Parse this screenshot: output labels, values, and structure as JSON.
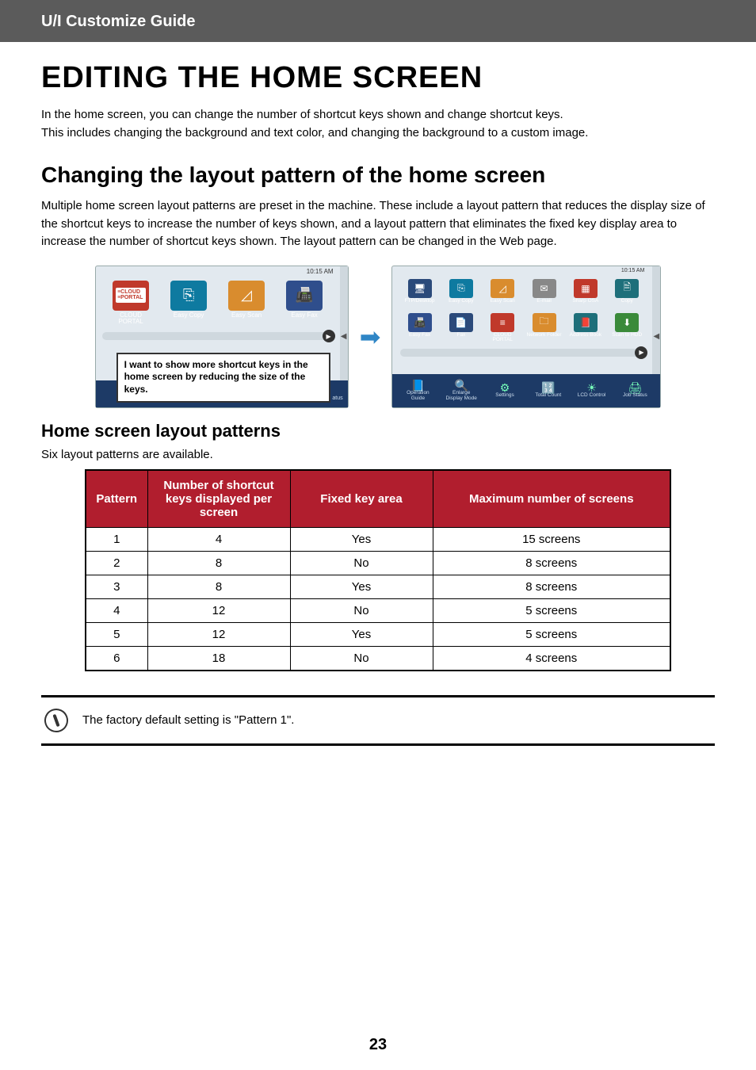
{
  "header": {
    "title": "U/I Customize Guide"
  },
  "h1": "EDITING THE HOME SCREEN",
  "intro_line1": "In the home screen, you can change the number of shortcut keys shown and change shortcut keys.",
  "intro_line2": "This includes changing the background and text color, and changing the background to a custom image.",
  "h2": "Changing the layout pattern of the home screen",
  "body": "Multiple home screen layout patterns are preset in the machine. These include a layout pattern that reduces the display size of the shortcut keys to increase the number of keys shown, and a layout pattern that eliminates the fixed key display area to increase the number of shortcut keys shown. The layout pattern can be changed in the Web page.",
  "mock_left": {
    "time": "10:15 AM",
    "icons": [
      {
        "label": "CLOUD PORTAL"
      },
      {
        "label": "Easy Copy"
      },
      {
        "label": "Easy Scan"
      },
      {
        "label": "Easy Fax"
      }
    ],
    "callout": "I want to show more shortcut keys in the home screen by reducing the size of the keys.",
    "status_stub": "atus"
  },
  "mock_right": {
    "time": "10:15 AM",
    "row1": [
      {
        "label": "FTP/Desktop"
      },
      {
        "label": "Easy Copy"
      },
      {
        "label": "Easy Scan"
      },
      {
        "label": "E-mail"
      },
      {
        "label": "Sharp OSA"
      },
      {
        "label": "Copy"
      }
    ],
    "row2": [
      {
        "label": "Easy Fax"
      },
      {
        "label": "Fax"
      },
      {
        "label": "CLOUD PORTAL"
      },
      {
        "label": "Network Folder"
      },
      {
        "label": "Address Book"
      },
      {
        "label": "Scan to HDD"
      }
    ],
    "bottom": [
      {
        "label": "Operation Guide"
      },
      {
        "label": "Enlarge Display Mode"
      },
      {
        "label": "Settings"
      },
      {
        "label": "Total Count"
      },
      {
        "label": "LCD Control"
      },
      {
        "label": "Job Status"
      }
    ]
  },
  "h3": "Home screen layout patterns",
  "patterns_intro": "Six layout patterns are available.",
  "table": {
    "headers": [
      "Pattern",
      "Number of shortcut keys displayed per screen",
      "Fixed key area",
      "Maximum number of screens"
    ],
    "rows": [
      [
        "1",
        "4",
        "Yes",
        "15 screens"
      ],
      [
        "2",
        "8",
        "No",
        "8 screens"
      ],
      [
        "3",
        "8",
        "Yes",
        "8 screens"
      ],
      [
        "4",
        "12",
        "No",
        "5 screens"
      ],
      [
        "5",
        "12",
        "Yes",
        "5 screens"
      ],
      [
        "6",
        "18",
        "No",
        "4 screens"
      ]
    ]
  },
  "note": "The factory default setting is \"Pattern 1\".",
  "page_number": "23"
}
